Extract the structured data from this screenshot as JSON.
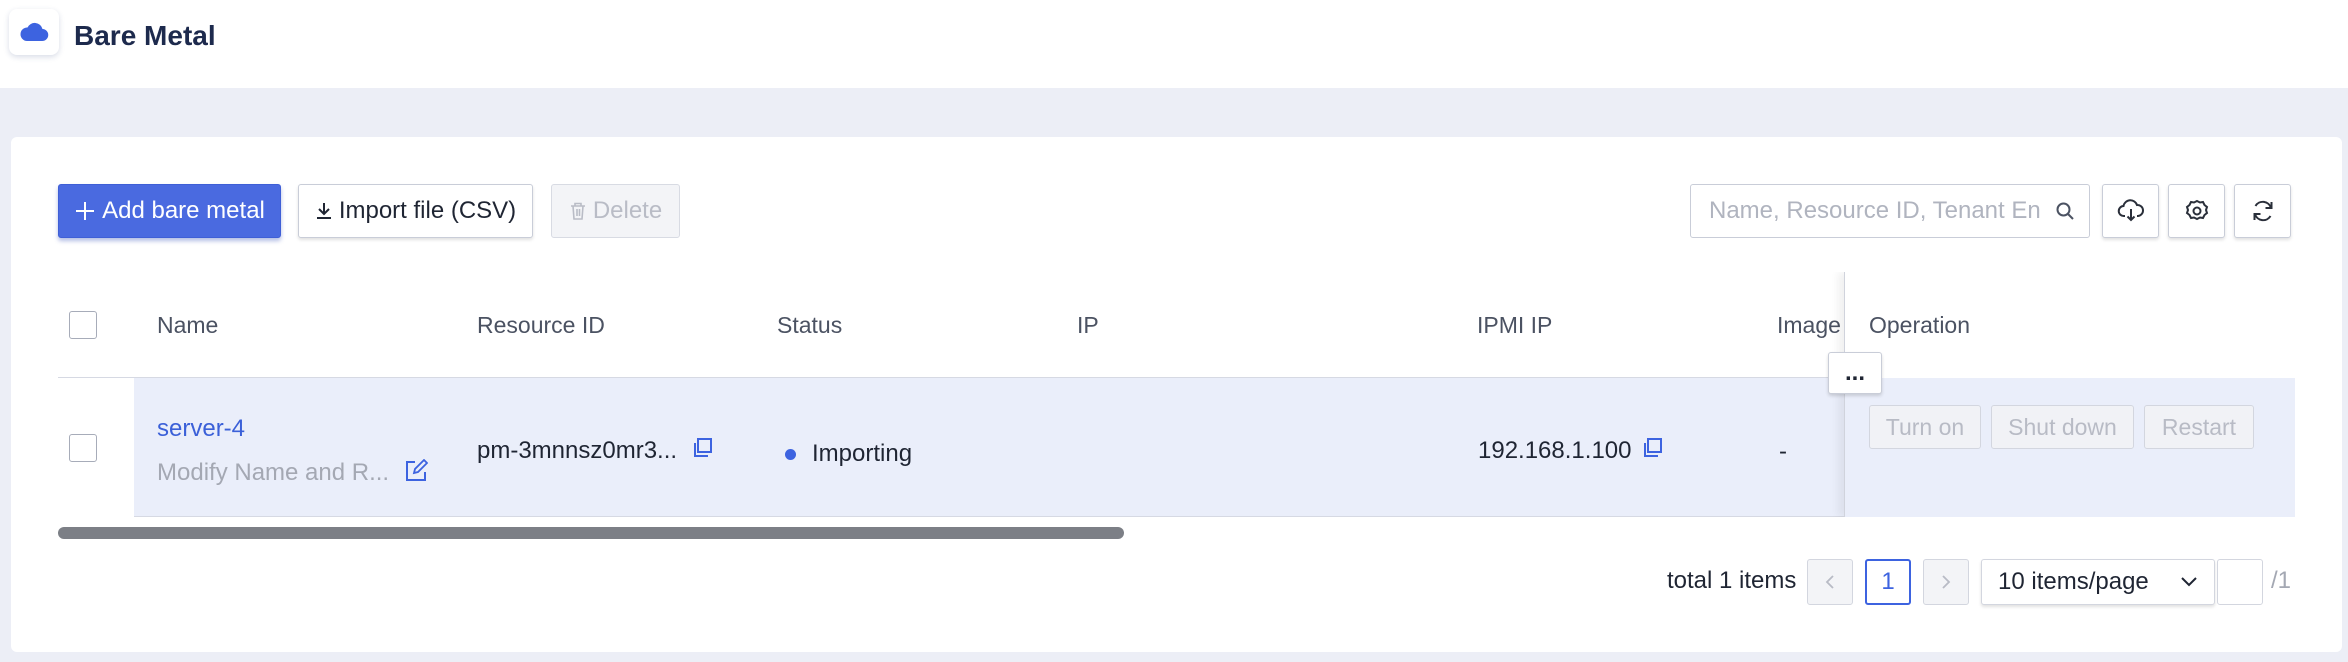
{
  "app": {
    "title": "Bare Metal",
    "logo_icon": "cloud-icon",
    "accent_color": "#4a6ae0"
  },
  "toolbar": {
    "add_label": "Add bare metal",
    "import_label": "Import file (CSV)",
    "delete_label": "Delete",
    "search_placeholder": "Name, Resource ID, Tenant En",
    "icons": [
      "search-icon",
      "cloud-download-icon",
      "gear-icon",
      "refresh-icon"
    ]
  },
  "table": {
    "columns": {
      "name": "Name",
      "resource_id": "Resource ID",
      "status": "Status",
      "ip": "IP",
      "ipmi_ip": "IPMI IP",
      "image": "Image",
      "operation": "Operation"
    },
    "rows": [
      {
        "name": "server-4",
        "subtitle": "Modify Name and R...",
        "resource_id": "pm-3mnnsz0mr3...",
        "status": "Importing",
        "status_color": "#3d63e0",
        "ip": "",
        "ipmi_ip": "192.168.1.100",
        "image": "-",
        "ops": {
          "turn_on": "Turn on",
          "shut_down": "Shut down",
          "restart": "Restart",
          "more": "..."
        }
      }
    ]
  },
  "pagination": {
    "total_text": "total 1 items",
    "current_page": "1",
    "page_size": "10 items/page",
    "total_pages_text": "/1",
    "jump_value": ""
  }
}
